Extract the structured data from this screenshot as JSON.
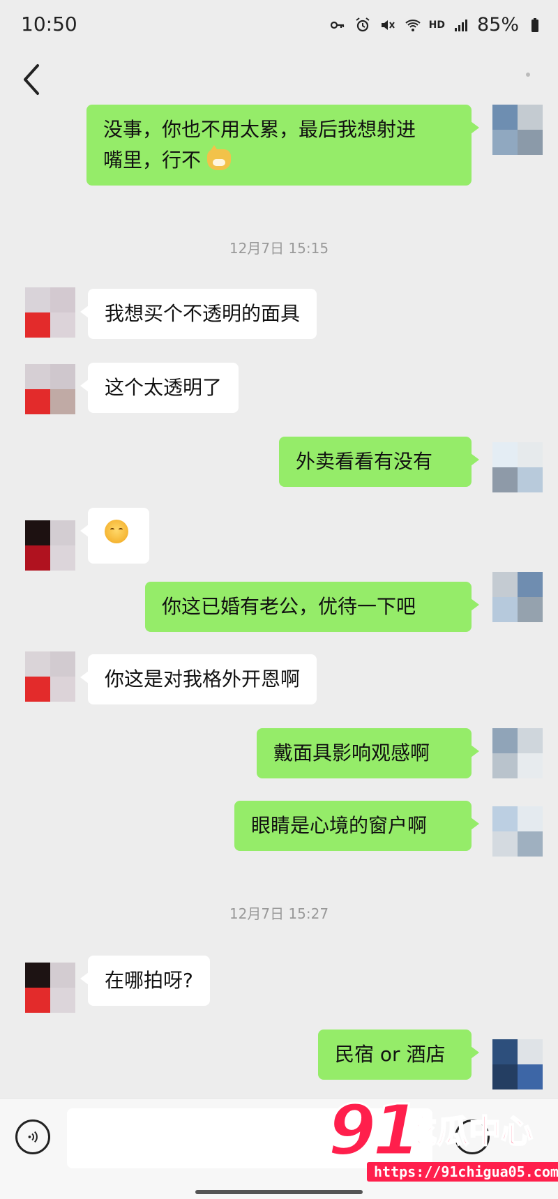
{
  "status_bar": {
    "time": "10:50",
    "network_label": "HD",
    "battery": "85%",
    "icons": [
      "key-icon",
      "alarm-icon",
      "mute-icon",
      "wifi-icon",
      "signal-icon",
      "battery-icon"
    ]
  },
  "header": {
    "back_icon": "chevron-left-icon",
    "title": ""
  },
  "colors": {
    "background": "#ededed",
    "outgoing_bubble": "#95ec69",
    "incoming_bubble": "#ffffff",
    "timestamp": "#999999",
    "watermark": "#ff1f4c"
  },
  "messages": [
    {
      "from": "me",
      "text": "没事，你也不用太累，最后我想射进",
      "text2": "嘴里，行不",
      "emoji": "doge-emoji"
    },
    {
      "type": "timestamp",
      "text": "12月7日 15:15"
    },
    {
      "from": "them",
      "text": "我想买个不透明的面具"
    },
    {
      "from": "them",
      "text": "这个太透明了"
    },
    {
      "from": "me",
      "text": "外卖看看有没有"
    },
    {
      "from": "them",
      "text": "",
      "emoji": "smirk-emoji"
    },
    {
      "from": "me",
      "text": "你这已婚有老公，优待一下吧"
    },
    {
      "from": "them",
      "text": "你这是对我格外开恩啊"
    },
    {
      "from": "me",
      "text": "戴面具影响观感啊"
    },
    {
      "from": "me",
      "text": "眼睛是心境的窗户啊"
    },
    {
      "type": "timestamp",
      "text": "12月7日 15:27"
    },
    {
      "from": "them",
      "text": "在哪拍呀?"
    },
    {
      "from": "me",
      "text": "民宿 or 酒店"
    }
  ],
  "input_bar": {
    "voice_icon": "voice-icon",
    "message_value": "",
    "emoji_icon": "emoji-icon"
  },
  "watermark": {
    "number": "91",
    "brand": "吃瓜中心",
    "url": "https://91chigua05.com"
  }
}
